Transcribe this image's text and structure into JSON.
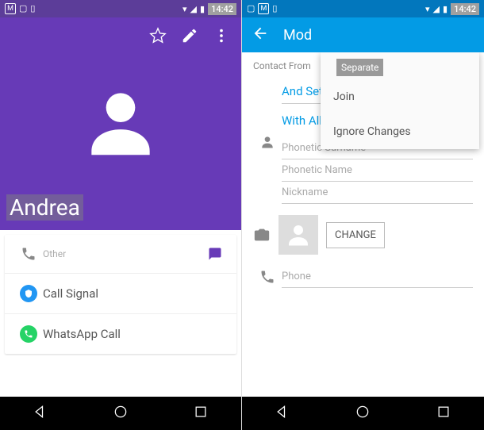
{
  "statusbar": {
    "time": "14:42"
  },
  "left": {
    "contact_name": "Andrea",
    "rows": {
      "other_label": "Other",
      "signal_label": "Call Signal",
      "whatsapp_label": "WhatsApp Call"
    }
  },
  "right": {
    "appbar_title": "Mod",
    "popup": {
      "separate": "Separate",
      "join": "Join",
      "ignore": "Ignore Changes"
    },
    "section_label": "Contact From",
    "set_ringtone": "And Set Ringtone",
    "voicemail": "With All Voicemail Calls",
    "fields": {
      "phonetic_surname": "Phonetic Surname",
      "phonetic_name": "Phonetic Name",
      "nickname": "Nickname",
      "phone": "Phone"
    },
    "change_btn": "CHANGE"
  }
}
